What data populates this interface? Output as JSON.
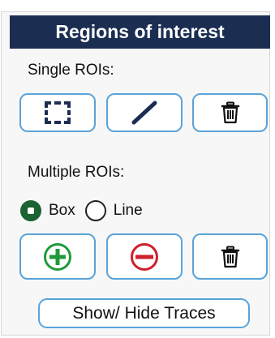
{
  "panel": {
    "title": "Regions of interest",
    "single_label": "Single ROIs:",
    "multiple_label": "Multiple ROIs:",
    "single_buttons": [
      {
        "icon": "box-select-icon"
      },
      {
        "icon": "line-draw-icon"
      },
      {
        "icon": "trash-icon"
      }
    ],
    "multi_mode": {
      "options": [
        {
          "label": "Box",
          "checked": true
        },
        {
          "label": "Line",
          "checked": false
        }
      ]
    },
    "multi_buttons": [
      {
        "icon": "add-circle-icon",
        "color": "#1f9a3a"
      },
      {
        "icon": "remove-circle-icon",
        "color": "#d01f2a"
      },
      {
        "icon": "trash-icon"
      }
    ],
    "traces_button": "Show/ Hide Traces"
  },
  "colors": {
    "header_bg": "#1b2e52",
    "button_border": "#5aa3d9",
    "radio_checked": "#1a6332",
    "add": "#1f9a3a",
    "remove": "#d01f2a"
  }
}
